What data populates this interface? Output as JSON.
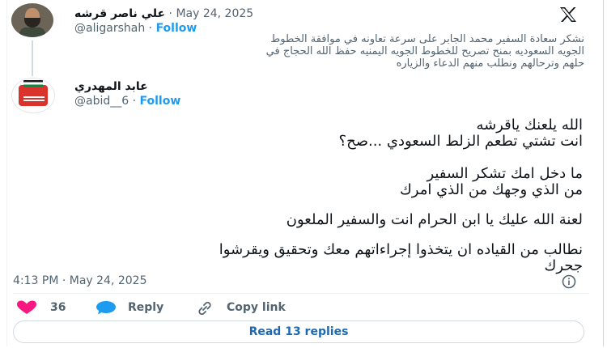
{
  "original_tweet": {
    "display_name": "علي ناصر قرشه",
    "separator": " · ",
    "date": "May 24, 2025",
    "handle": "@aligarshah",
    "follow_label": "Follow",
    "lines": [
      "نشكر سعادة السفير محمد الجابر على سرعة تعاونه في موافقة الخطوط",
      "الجويه السعوديه بمنح تصريح للخطوط الجويه اليمنيه حفظ الله الحجاج في",
      "حلهم وترحالهم ونطلب منهم الدعاء والزياره"
    ]
  },
  "reply_tweet": {
    "display_name": "عابد المهدري",
    "handle": "@abid__6",
    "follow_label": "Follow",
    "lines": [
      "الله يلعنك ياقرشه",
      "انت تشتي تطعم الزلط السعودي ...صح؟",
      "ما دخل امك تشكر السفير",
      "من الذي وجهك من الذي امرك",
      "لعنة الله عليك يا ابن الحرام انت والسفير الملعون",
      "نطالب من  القياده ان يتخذوا إجراءاتهم معك وتحقيق ويقرشوا",
      "جحرك"
    ],
    "timestamp": "4:13 PM · May 24, 2025"
  },
  "actions": {
    "like_count": "36",
    "reply_label": "Reply",
    "copy_label": "Copy link"
  },
  "read_replies_label": "Read 13 replies",
  "icons": [
    "x-logo-icon",
    "heart-icon",
    "reply-bubble-icon",
    "link-icon",
    "info-icon"
  ],
  "colors": {
    "accent": "#1d9bf0",
    "like": "#f91880",
    "muted": "#536471",
    "text": "#0f1419"
  }
}
